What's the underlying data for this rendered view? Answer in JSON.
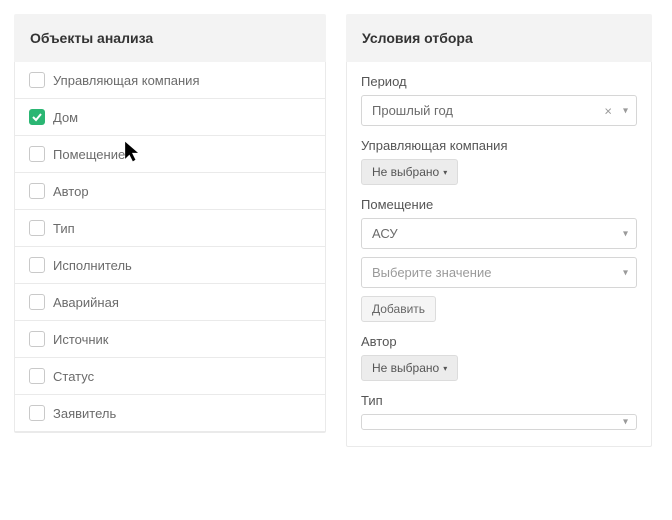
{
  "left": {
    "title": "Объекты анализа",
    "items": [
      {
        "label": "Управляющая компания",
        "checked": false
      },
      {
        "label": "Дом",
        "checked": true
      },
      {
        "label": "Помещение",
        "checked": false
      },
      {
        "label": "Автор",
        "checked": false
      },
      {
        "label": "Тип",
        "checked": false
      },
      {
        "label": "Исполнитель",
        "checked": false
      },
      {
        "label": "Аварийная",
        "checked": false
      },
      {
        "label": "Источник",
        "checked": false
      },
      {
        "label": "Статус",
        "checked": false
      },
      {
        "label": "Заявитель",
        "checked": false
      }
    ]
  },
  "right": {
    "title": "Условия отбора",
    "period": {
      "label": "Период",
      "value": "Прошлый год"
    },
    "company": {
      "label": "Управляющая компания",
      "value": "Не выбрано"
    },
    "room": {
      "label": "Помещение",
      "value": "АСУ",
      "placeholder": "Выберите значение",
      "add_label": "Добавить"
    },
    "author": {
      "label": "Автор",
      "value": "Не выбрано"
    },
    "type": {
      "label": "Тип",
      "value": ""
    }
  }
}
